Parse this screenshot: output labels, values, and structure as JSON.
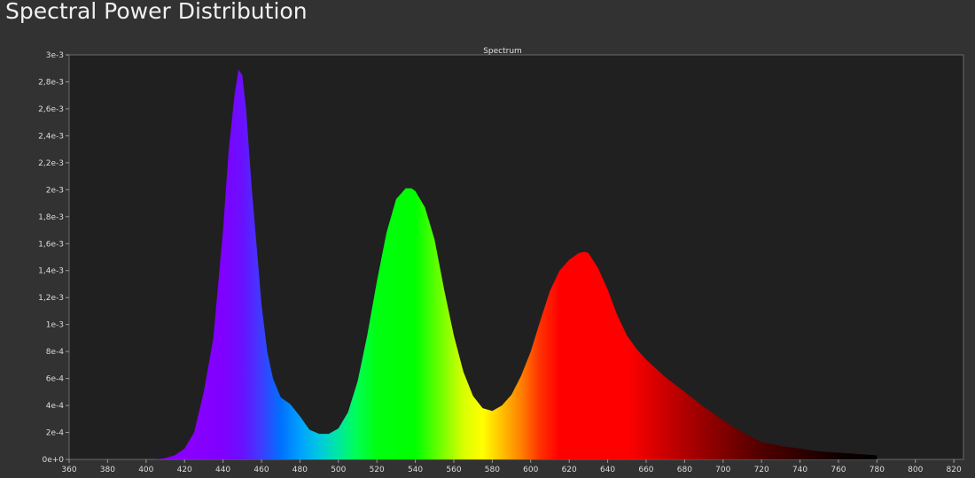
{
  "header": {
    "title": "Spectral Power Distribution"
  },
  "chart_data": {
    "type": "area",
    "title": "Spectrum",
    "xlabel": "",
    "ylabel": "",
    "xlim": [
      360,
      825
    ],
    "ylim": [
      0,
      0.003
    ],
    "grid": false,
    "x_ticks": [
      360,
      380,
      400,
      420,
      440,
      460,
      480,
      500,
      520,
      540,
      560,
      580,
      600,
      620,
      640,
      660,
      680,
      700,
      720,
      740,
      760,
      780,
      800,
      820
    ],
    "y_ticks": [
      {
        "value": 0,
        "label": "0e+0"
      },
      {
        "value": 0.0002,
        "label": "2e-4"
      },
      {
        "value": 0.0004,
        "label": "4e-4"
      },
      {
        "value": 0.0006,
        "label": "6e-4"
      },
      {
        "value": 0.0008,
        "label": "8e-4"
      },
      {
        "value": 0.001,
        "label": "1e-3"
      },
      {
        "value": 0.0012,
        "label": "1,2e-3"
      },
      {
        "value": 0.0014,
        "label": "1,4e-3"
      },
      {
        "value": 0.0016,
        "label": "1,6e-3"
      },
      {
        "value": 0.0018,
        "label": "1,8e-3"
      },
      {
        "value": 0.002,
        "label": "2e-3"
      },
      {
        "value": 0.0022,
        "label": "2,2e-3"
      },
      {
        "value": 0.0024,
        "label": "2,4e-3"
      },
      {
        "value": 0.0026,
        "label": "2,6e-3"
      },
      {
        "value": 0.0028,
        "label": "2,8e-3"
      },
      {
        "value": 0.003,
        "label": "3e-3"
      }
    ],
    "series": [
      {
        "x": [
          405,
          410,
          415,
          420,
          425,
          430,
          435,
          440,
          443,
          446,
          448,
          450,
          452,
          455,
          458,
          460,
          463,
          466,
          470,
          475,
          480,
          485,
          490,
          495,
          500,
          505,
          510,
          515,
          520,
          525,
          530,
          535,
          538,
          540,
          545,
          550,
          555,
          560,
          565,
          570,
          575,
          580,
          585,
          590,
          595,
          600,
          605,
          610,
          615,
          620,
          625,
          628,
          630,
          635,
          640,
          645,
          650,
          655,
          660,
          670,
          680,
          690,
          700,
          710,
          720,
          730,
          740,
          750,
          760,
          770,
          780
        ],
        "y": [
          0.0,
          1e-05,
          3e-05,
          8e-05,
          0.0002,
          0.0005,
          0.0009,
          0.0017,
          0.0023,
          0.0027,
          0.00289,
          0.00285,
          0.0026,
          0.002,
          0.0015,
          0.00115,
          0.0008,
          0.0006,
          0.00046,
          0.00041,
          0.00032,
          0.00022,
          0.00019,
          0.00019,
          0.00023,
          0.00035,
          0.00058,
          0.00092,
          0.00132,
          0.00168,
          0.00193,
          0.00201,
          0.00201,
          0.00199,
          0.00187,
          0.00163,
          0.00126,
          0.00092,
          0.00065,
          0.00047,
          0.00038,
          0.00036,
          0.0004,
          0.00048,
          0.00062,
          0.0008,
          0.00103,
          0.00125,
          0.0014,
          0.00148,
          0.00153,
          0.00154,
          0.00153,
          0.00142,
          0.00126,
          0.00107,
          0.00092,
          0.00082,
          0.00074,
          0.00061,
          0.0005,
          0.00039,
          0.00029,
          0.0002,
          0.00013,
          0.0001,
          8e-05,
          6e-05,
          5e-05,
          4e-05,
          3e-05
        ]
      }
    ]
  }
}
